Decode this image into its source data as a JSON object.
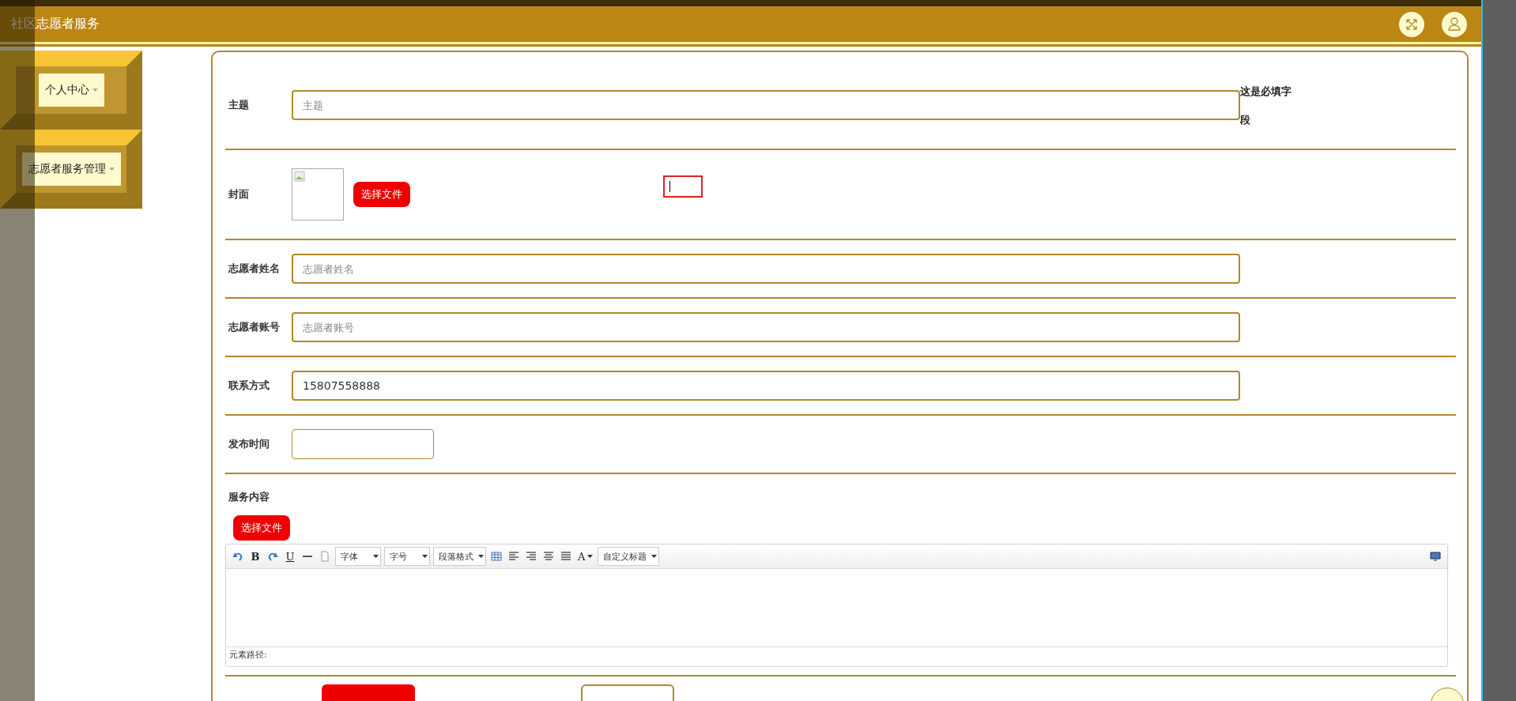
{
  "header": {
    "title": "社区志愿者服务"
  },
  "sidebar": {
    "items": [
      {
        "label": "个人中心"
      },
      {
        "label": "志愿者服务管理"
      }
    ]
  },
  "form": {
    "fields": [
      {
        "kind": "text",
        "label": "主题",
        "placeholder": "主题",
        "hint": "这是必填字段"
      },
      {
        "kind": "image",
        "label": "封面",
        "button": "选择文件"
      },
      {
        "kind": "text",
        "label": "志愿者姓名",
        "placeholder": "志愿者姓名"
      },
      {
        "kind": "text",
        "label": "志愿者账号",
        "placeholder": "志愿者账号"
      },
      {
        "kind": "text",
        "label": "联系方式",
        "value": "15807558888"
      },
      {
        "kind": "date",
        "label": "发布时间"
      },
      {
        "kind": "editor",
        "label": "服务内容",
        "button": "选择文件",
        "path_label": "元素路径:",
        "toolbar": [
          {
            "kind": "undo"
          },
          {
            "kind": "bold",
            "label": "B"
          },
          {
            "kind": "redo"
          },
          {
            "kind": "underline",
            "label": "U"
          },
          {
            "kind": "rule"
          },
          {
            "kind": "page"
          },
          {
            "kind": "select",
            "label": "字体"
          },
          {
            "kind": "select",
            "label": "字号"
          },
          {
            "kind": "select",
            "label": "段落格式"
          },
          {
            "kind": "table"
          },
          {
            "kind": "align-left"
          },
          {
            "kind": "align-right"
          },
          {
            "kind": "align-center"
          },
          {
            "kind": "justify"
          },
          {
            "kind": "font-color",
            "label": "A"
          },
          {
            "kind": "select",
            "label": "自定义标题"
          }
        ]
      }
    ],
    "actions": [
      {
        "kind": "primary"
      },
      {
        "kind": "outline"
      }
    ]
  }
}
